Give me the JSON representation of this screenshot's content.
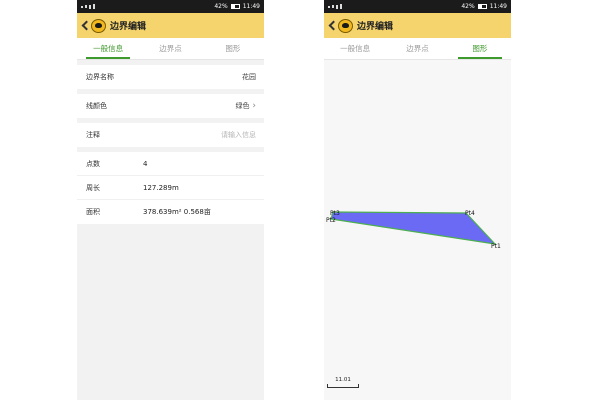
{
  "status_bar": {
    "battery": "42%",
    "time": "11:49"
  },
  "header": {
    "title": "边界编辑",
    "back_icon": "back-arrow-icon",
    "logo_icon": "app-logo-icon",
    "bg_color": "#f5d46e"
  },
  "tabs": [
    {
      "label": "一般信息"
    },
    {
      "label": "边界点"
    },
    {
      "label": "图形"
    }
  ],
  "left_screen": {
    "active_tab": 0,
    "name": {
      "label": "边界名称",
      "value": "花园"
    },
    "line_color": {
      "label": "线颜色",
      "value": "绿色"
    },
    "note": {
      "label": "注释",
      "placeholder": "请输入信息"
    },
    "stats": [
      {
        "label": "点数",
        "value": "4"
      },
      {
        "label": "周长",
        "value": "127.289m"
      },
      {
        "label": "面积",
        "value": "378.639m²  0.568亩"
      }
    ]
  },
  "right_screen": {
    "active_tab": 2,
    "points": [
      {
        "name": "Pt1"
      },
      {
        "name": "Pt2"
      },
      {
        "name": "Pt3"
      },
      {
        "name": "Pt4"
      }
    ],
    "fill_color": "#6a6af5",
    "stroke_color": "#4caf50",
    "scale_label": "11.01"
  },
  "accent_color": "#3f9a2d"
}
